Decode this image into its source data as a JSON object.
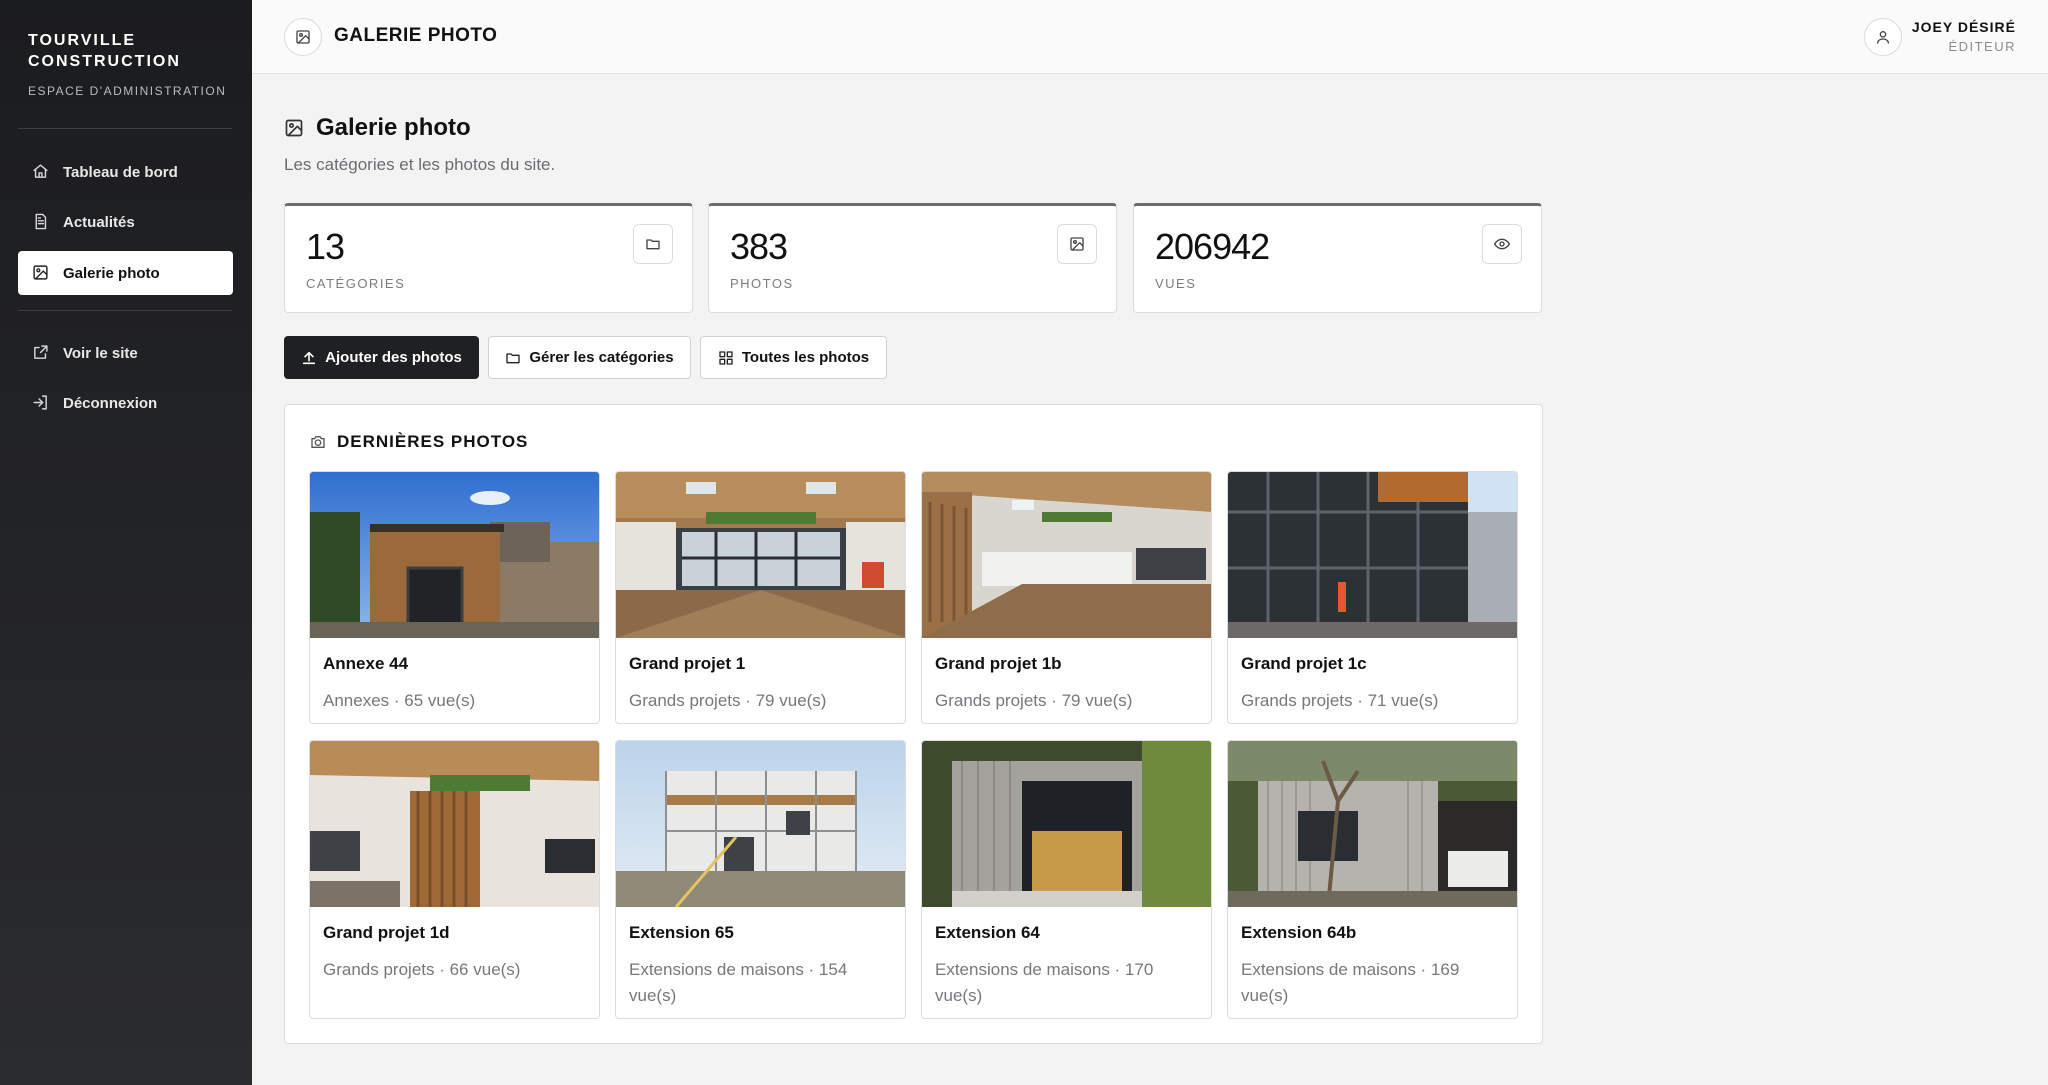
{
  "brand": {
    "name_line1": "TOURVILLE",
    "name_line2": "CONSTRUCTION",
    "subtitle": "ESPACE D'ADMINISTRATION"
  },
  "sidebar": {
    "items": [
      {
        "label": "Tableau de bord",
        "icon": "home-icon"
      },
      {
        "label": "Actualités",
        "icon": "document-icon"
      },
      {
        "label": "Galerie photo",
        "icon": "image-icon",
        "active": true
      },
      {
        "label": "Voir le site",
        "icon": "external-link-icon"
      },
      {
        "label": "Déconnexion",
        "icon": "logout-icon"
      }
    ]
  },
  "header": {
    "title": "GALERIE PHOTO",
    "user_name": "JOEY DÉSIRÉ",
    "user_role": "ÉDITEUR"
  },
  "page": {
    "title": "Galerie photo",
    "subtitle": "Les catégories et les photos du site."
  },
  "stats": [
    {
      "value": "13",
      "label": "CATÉGORIES",
      "icon": "folder-icon"
    },
    {
      "value": "383",
      "label": "PHOTOS",
      "icon": "image-icon"
    },
    {
      "value": "206942",
      "label": "VUES",
      "icon": "eye-icon"
    }
  ],
  "actions": {
    "add_photos": "Ajouter des photos",
    "manage_categories": "Gérer les catégories",
    "all_photos": "Toutes les photos"
  },
  "gallery": {
    "title": "DERNIÈRES PHOTOS",
    "photos": [
      {
        "title": "Annexe 44",
        "meta": "Annexes · 65 vue(s)"
      },
      {
        "title": "Grand projet 1",
        "meta": "Grands projets · 79 vue(s)"
      },
      {
        "title": "Grand projet 1b",
        "meta": "Grands projets · 79 vue(s)"
      },
      {
        "title": "Grand projet 1c",
        "meta": "Grands projets · 71 vue(s)"
      },
      {
        "title": "Grand projet 1d",
        "meta": "Grands projets · 66 vue(s)"
      },
      {
        "title": "Extension 65",
        "meta": "Extensions de maisons · 154 vue(s)"
      },
      {
        "title": "Extension 64",
        "meta": "Extensions de maisons · 170 vue(s)"
      },
      {
        "title": "Extension 64b",
        "meta": "Extensions de maisons · 169 vue(s)"
      }
    ]
  }
}
